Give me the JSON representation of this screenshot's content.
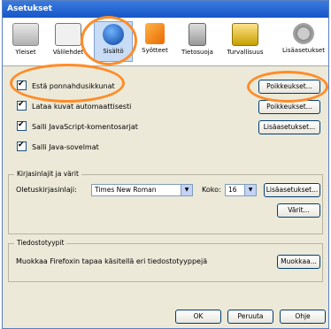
{
  "window": {
    "title": "Asetukset"
  },
  "toolbar": {
    "items": [
      {
        "label": "Yleiset",
        "icon": "settings-panel-icon"
      },
      {
        "label": "Välilehdet",
        "icon": "tabs-icon"
      },
      {
        "label": "Sisältö",
        "icon": "globe-icon"
      },
      {
        "label": "Syötteet",
        "icon": "feed-icon"
      },
      {
        "label": "Tietosuoja",
        "icon": "lock-icon"
      },
      {
        "label": "Turvallisuus",
        "icon": "security-icon"
      },
      {
        "label": "Lisäasetukset",
        "icon": "gear-icon"
      }
    ]
  },
  "content": {
    "checkboxes": [
      {
        "label": "Estä ponnahdusikkunat",
        "checked": true
      },
      {
        "label": "Lataa kuvat automaattisesti",
        "checked": true
      },
      {
        "label": "Salli JavaScript-komentosarjat",
        "checked": true
      },
      {
        "label": "Salli Java-sovelmat",
        "checked": true
      }
    ],
    "buttons": {
      "exceptions1": "Poikkeukset...",
      "exceptions2": "Poikkeukset...",
      "advanced": "Lisäasetukset..."
    },
    "fonts": {
      "legend": "Kirjasinlajit ja värit",
      "default_font_label": "Oletuskirjasinlaji:",
      "default_font_value": "Times New Roman",
      "size_label": "Koko:",
      "size_value": "16",
      "advanced_button": "Lisäasetukset...",
      "colors_button": "Värit..."
    },
    "filetypes": {
      "legend": "Tiedostotyypit",
      "description": "Muokkaa Firefoxin tapaa käsitellä eri tiedostotyyppejä",
      "manage_button": "Muokkaa..."
    }
  },
  "footer": {
    "ok": "OK",
    "cancel": "Peruuta",
    "help": "Ohje"
  }
}
